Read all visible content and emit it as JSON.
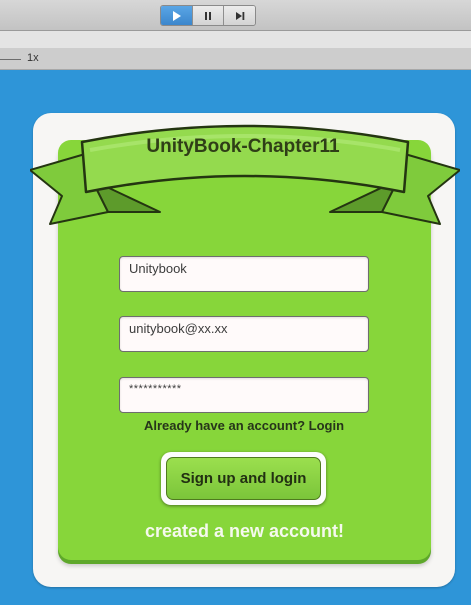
{
  "toolbar": {
    "buttons": [
      {
        "name": "play",
        "icon": "play-icon",
        "active": true
      },
      {
        "name": "pause",
        "icon": "pause-icon",
        "active": false
      },
      {
        "name": "step",
        "icon": "step-icon",
        "active": false
      }
    ]
  },
  "game_view": {
    "scale_label": "1x"
  },
  "banner": {
    "title": "UnityBook-Chapter11"
  },
  "form": {
    "username_value": "Unitybook",
    "email_value": "unitybook@xx.xx",
    "password_value": "***********",
    "login_link": "Already have an account? Login",
    "signup_label": "Sign up and login",
    "status_message": "created a new account!"
  },
  "colors": {
    "background": "#2e95d8",
    "panel": "#87d63a",
    "ribbon": "#8fd84a",
    "text_dark": "#2f3e17"
  }
}
